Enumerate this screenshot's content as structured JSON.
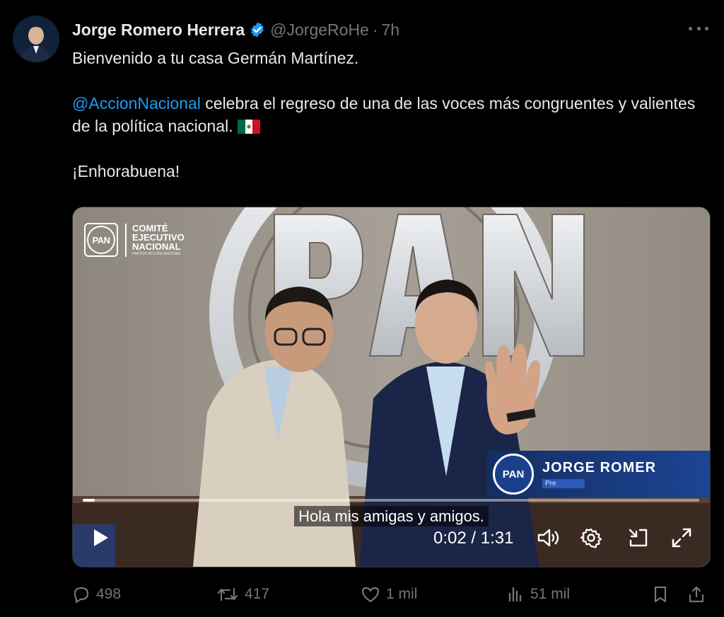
{
  "tweet": {
    "author_name": "Jorge Romero Herrera",
    "handle": "@JorgeRoHe",
    "separator": "·",
    "time": "7h",
    "line1": "Bienvenido a tu casa Germán Martínez.",
    "mention": "@AccionNacional",
    "line2_rest": " celebra el regreso de una de las voces más congruentes y valientes de la política nacional.",
    "line3": "¡Enhorabuena!"
  },
  "video": {
    "logo_text": "PAN",
    "org_line1": "COMITÉ",
    "org_line2": "EJECUTIVO",
    "org_line3": "NACIONAL",
    "org_subline": "PARTIDO ACCIÓN NACIONAL",
    "lower_third_name": "JORGE ROMER",
    "lower_third_title": "Pre",
    "caption": "Hola mis amigas y amigos.",
    "time_display": "0:02 / 1:31",
    "progress": 0.02
  },
  "actions": {
    "replies": "498",
    "reposts": "417",
    "likes": "1 mil",
    "views": "51 mil"
  },
  "icons": [
    "verified-badge-icon",
    "more-icon",
    "mexico-flag-icon",
    "play-icon",
    "volume-icon",
    "settings-icon",
    "pip-icon",
    "fullscreen-icon",
    "reply-icon",
    "repost-icon",
    "like-icon",
    "views-icon",
    "bookmark-icon",
    "share-icon"
  ],
  "colors": {
    "accent": "#1d9bf0",
    "background": "#000000",
    "muted": "#71767b",
    "text": "#e7e9ea"
  }
}
